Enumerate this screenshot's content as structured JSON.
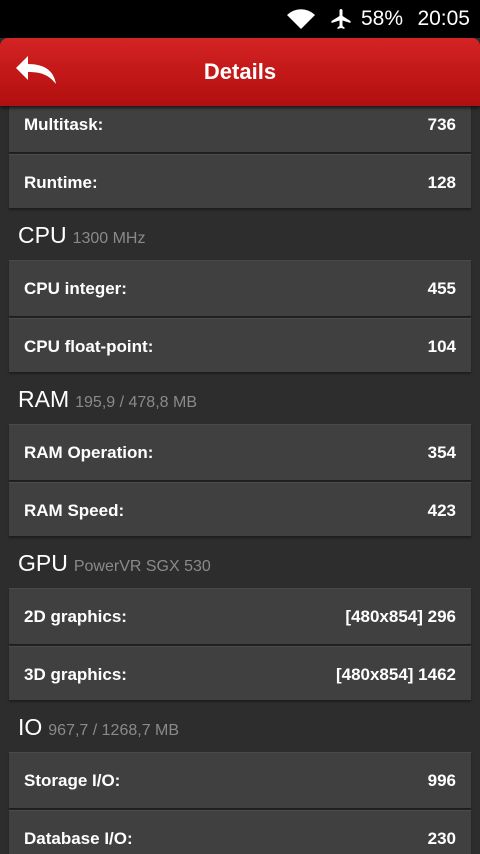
{
  "status_bar": {
    "battery": "58%",
    "time": "20:05",
    "icons": [
      "wifi-icon",
      "airplane-mode-icon"
    ]
  },
  "header": {
    "title": "Details",
    "back_icon": "back-arrow-icon"
  },
  "colors": {
    "header_red": "#c01616",
    "background": "#2d2d2d",
    "card": "#404040",
    "muted_text": "#8a8a8a"
  },
  "rows_top": [
    {
      "label": "Multitask:",
      "value": "736"
    },
    {
      "label": "Runtime:",
      "value": "128"
    }
  ],
  "sections": [
    {
      "title": "CPU",
      "subtitle": "1300 MHz",
      "rows": [
        {
          "label": "CPU integer:",
          "value": "455"
        },
        {
          "label": "CPU float-point:",
          "value": "104"
        }
      ]
    },
    {
      "title": "RAM",
      "subtitle": "195,9 / 478,8 MB",
      "rows": [
        {
          "label": "RAM Operation:",
          "value": "354"
        },
        {
          "label": "RAM Speed:",
          "value": "423"
        }
      ]
    },
    {
      "title": "GPU",
      "subtitle": "PowerVR SGX 530",
      "rows": [
        {
          "label": "2D graphics:",
          "value": "[480x854] 296"
        },
        {
          "label": "3D graphics:",
          "value": "[480x854] 1462"
        }
      ]
    },
    {
      "title": "IO",
      "subtitle": "967,7 / 1268,7 MB",
      "rows": [
        {
          "label": "Storage I/O:",
          "value": "996"
        },
        {
          "label": "Database I/O:",
          "value": "230"
        }
      ]
    }
  ]
}
